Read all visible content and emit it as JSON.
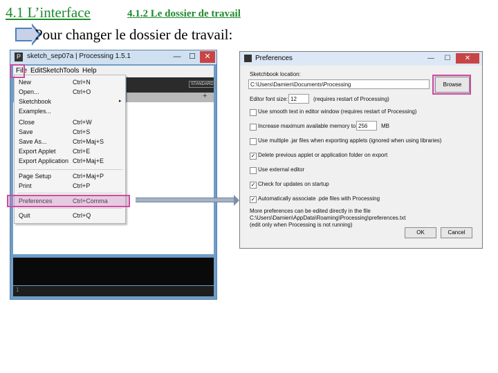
{
  "slide": {
    "heading": "4.1 L’interface",
    "subheading": "4.1.2 Le dossier de travail",
    "instruction": "Pour changer le dossier de travail:"
  },
  "processing_window": {
    "title": "sketch_sep07a | Processing 1.5.1",
    "controls": {
      "minimize": "—",
      "maximize": "☐",
      "close": "✕"
    },
    "menus": [
      "File",
      "Edit",
      "Sketch",
      "Tools",
      "Help"
    ],
    "mode_button": "STANDARD",
    "tab_add": "+",
    "line_number": "1"
  },
  "file_menu": {
    "items": [
      {
        "label": "New",
        "shortcut": "Ctrl+N"
      },
      {
        "label": "Open...",
        "shortcut": "Ctrl+O"
      },
      {
        "label": "Sketchbook",
        "shortcut": "",
        "submenu": "▸"
      },
      {
        "label": "Examples...",
        "shortcut": ""
      },
      {
        "label": "Close",
        "shortcut": "Ctrl+W"
      },
      {
        "label": "Save",
        "shortcut": "Ctrl+S"
      },
      {
        "label": "Save As...",
        "shortcut": "Ctrl+Maj+S"
      },
      {
        "label": "Export Applet",
        "shortcut": "Ctrl+E"
      },
      {
        "label": "Export Application",
        "shortcut": "Ctrl+Maj+E"
      },
      {
        "label": "Page Setup",
        "shortcut": "Ctrl+Maj+P"
      },
      {
        "label": "Print",
        "shortcut": "Ctrl+P"
      },
      {
        "label": "Preferences",
        "shortcut": "Ctrl+Comma"
      },
      {
        "label": "Quit",
        "shortcut": "Ctrl+Q"
      }
    ]
  },
  "preferences": {
    "title": "Preferences",
    "controls": {
      "minimize": "—",
      "maximize": "☐",
      "close": "✕"
    },
    "sketchbook_label": "Sketchbook location:",
    "sketchbook_path": "C:\\Users\\Damien\\Documents\\Processing",
    "browse_label": "Browse",
    "font_size_label": "Editor font size:",
    "font_size_value": "12",
    "font_size_note": "(requires restart of Processing)",
    "options": [
      {
        "label": "Use smooth text in editor window (requires restart of Processing)",
        "checked": false
      },
      {
        "label": "Increase maximum available memory to",
        "checked": false
      },
      {
        "label": "Use multiple .jar files when exporting applets (ignored when using libraries)",
        "checked": false
      },
      {
        "label": "Delete previous applet or application folder on export",
        "checked": true
      },
      {
        "label": "Use external editor",
        "checked": false
      },
      {
        "label": "Check for updates on startup",
        "checked": true
      },
      {
        "label": "Automatically associate .pde files with Processing",
        "checked": true
      }
    ],
    "memory_value": "256",
    "memory_unit": "MB",
    "note_1": "More preferences can be edited directly in the file",
    "note_2": "C:\\Users\\Damien\\AppData\\Roaming\\Processing\\preferences.txt",
    "note_3": "(edit only when Processing is not running)",
    "ok_label": "OK",
    "cancel_label": "Cancel"
  }
}
